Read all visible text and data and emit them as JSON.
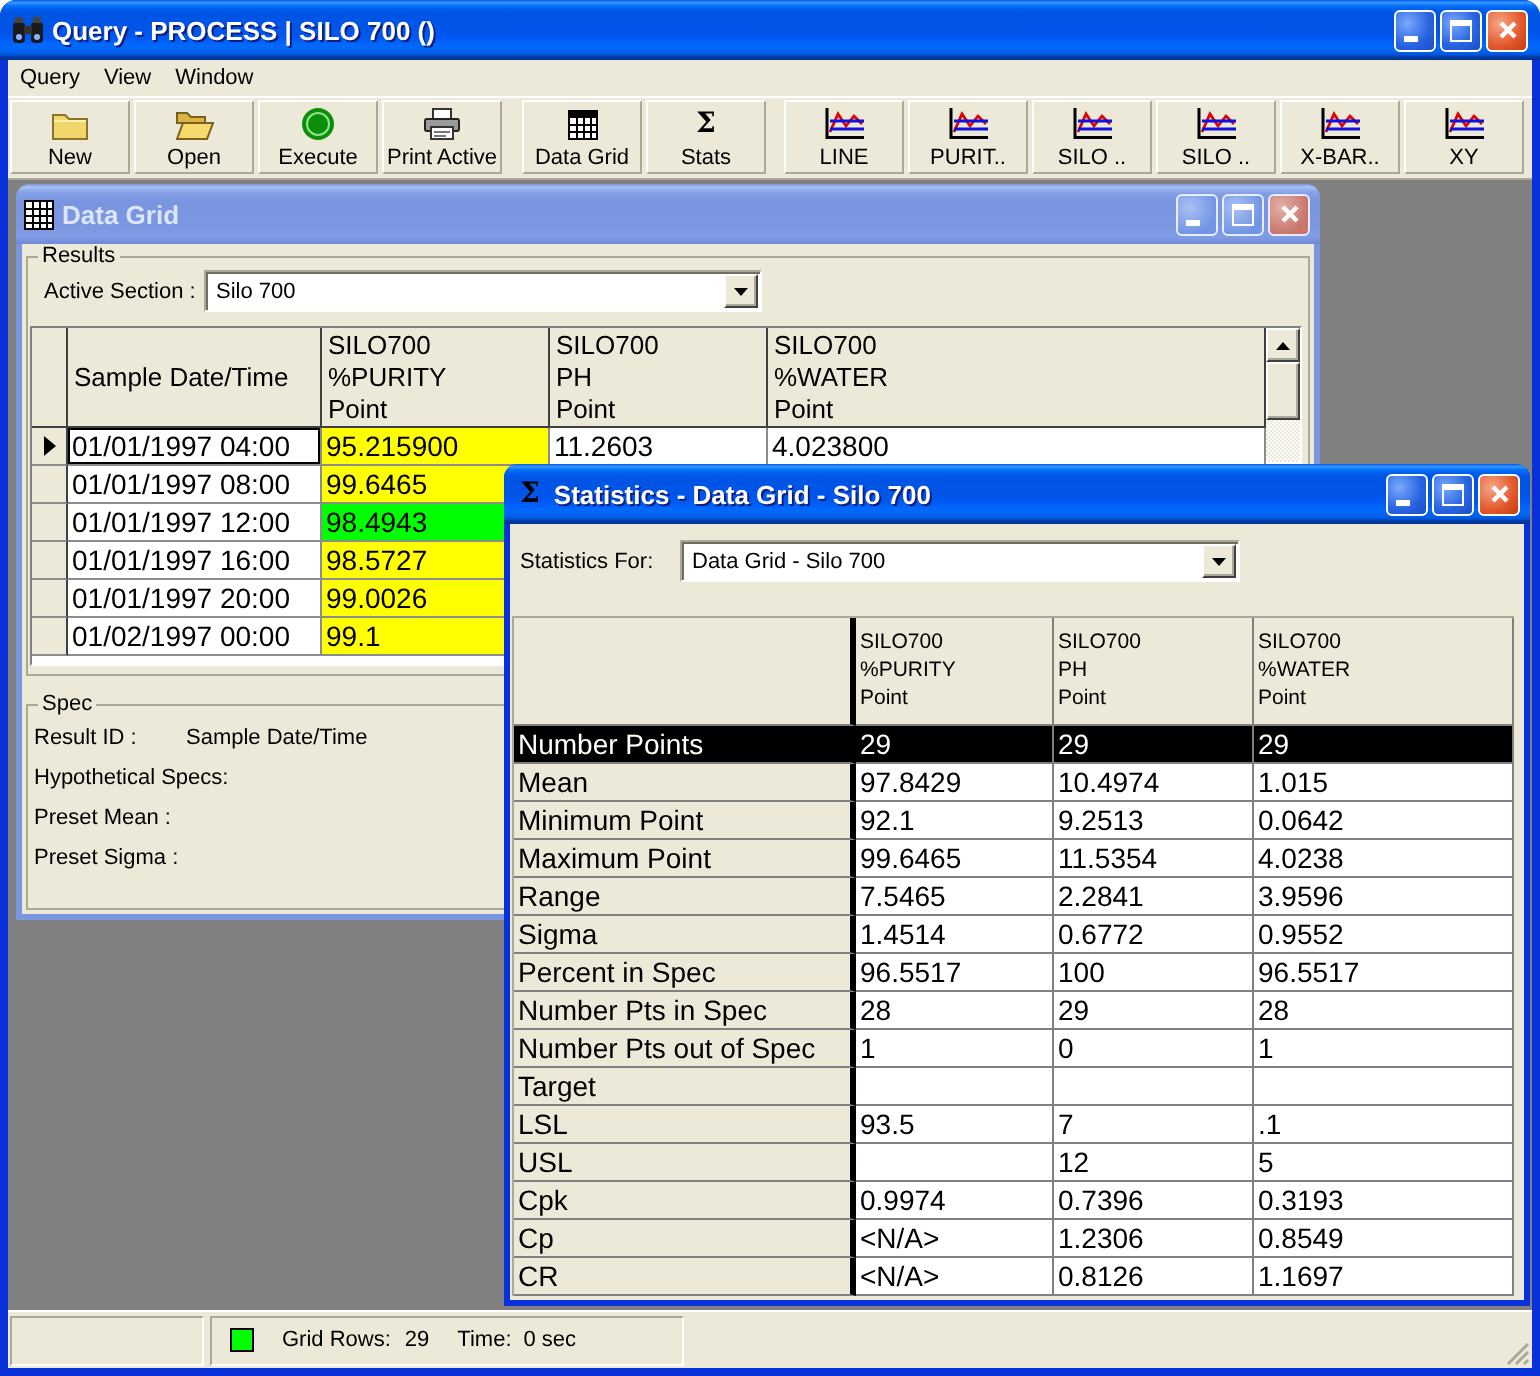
{
  "window": {
    "title": "Query - PROCESS | SILO 700 ()",
    "active": true
  },
  "menu": [
    {
      "label": "Query"
    },
    {
      "label": "View"
    },
    {
      "label": "Window"
    }
  ],
  "toolbar": [
    {
      "buttons": [
        {
          "label": "New",
          "kind": "folder"
        },
        {
          "label": "Open",
          "kind": "open-folder"
        },
        {
          "label": "Execute",
          "kind": "go"
        },
        {
          "label": "Print Active",
          "kind": "printer"
        }
      ]
    },
    {
      "buttons": [
        {
          "label": "Data Grid",
          "kind": "grid"
        },
        {
          "label": "Stats",
          "kind": "sigma",
          "glyph": "Σ"
        }
      ]
    },
    {
      "buttons": [
        {
          "label": "LINE",
          "kind": "chart"
        },
        {
          "label": "PURIT..",
          "kind": "chart"
        },
        {
          "label": "SILO ..",
          "kind": "chart"
        },
        {
          "label": "SILO ..",
          "kind": "chart"
        },
        {
          "label": "X-BAR..",
          "kind": "chart"
        },
        {
          "label": "XY",
          "kind": "chart"
        }
      ]
    }
  ],
  "data_grid_window": {
    "title": "Data Grid",
    "active": false,
    "results": {
      "label": "Results",
      "active_section": {
        "label": "Active Section :",
        "value": "Silo 700"
      },
      "columns": [
        "Sample Date/Time",
        "SILO700\n%PURITY\nPoint",
        "SILO700\nPH\nPoint",
        "SILO700\n%WATER\nPoint"
      ],
      "rows": [
        {
          "selected": true,
          "cells": [
            {
              "text": "01/01/1997 04:00"
            },
            {
              "text": "95.215900",
              "color": "#ffff00"
            },
            {
              "text": "11.2603"
            },
            {
              "text": "4.023800"
            }
          ]
        },
        {
          "selected": false,
          "cells": [
            {
              "text": "01/01/1997 08:00"
            },
            {
              "text": "99.6465",
              "color": "#ffff00"
            }
          ]
        },
        {
          "selected": false,
          "cells": [
            {
              "text": "01/01/1997 12:00"
            },
            {
              "text": "98.4943",
              "color": "#00ff00"
            }
          ]
        },
        {
          "selected": false,
          "cells": [
            {
              "text": "01/01/1997 16:00"
            },
            {
              "text": "98.5727",
              "color": "#ffff00"
            }
          ]
        },
        {
          "selected": false,
          "cells": [
            {
              "text": "01/01/1997 20:00"
            },
            {
              "text": "99.0026",
              "color": "#ffff00"
            }
          ]
        },
        {
          "selected": false,
          "cells": [
            {
              "text": "01/02/1997 00:00"
            },
            {
              "text": "99.1",
              "color": "#ffff00"
            }
          ]
        }
      ]
    },
    "spec": {
      "label": "Spec",
      "fields": [
        {
          "label": "Result ID :",
          "value": "Sample Date/Time"
        },
        {
          "label": "Hypothetical Specs:"
        },
        {
          "label": "Preset Mean :"
        },
        {
          "label": "Preset Sigma :"
        }
      ]
    }
  },
  "statistics_window": {
    "title": "Statistics - Data Grid - Silo 700",
    "glyph": "Σ",
    "active": true,
    "statistics_for": {
      "label": "Statistics For:",
      "value": "Data Grid - Silo 700"
    },
    "columns": [
      "SILO700\n%PURITY\nPoint",
      "SILO700\nPH\nPoint",
      "SILO700\n%WATER\nPoint"
    ],
    "rows": [
      {
        "label": "Number Points",
        "selected": true,
        "purity": "29",
        "ph": "29",
        "water": "29"
      },
      {
        "label": "Mean",
        "selected": false,
        "purity": "97.8429",
        "ph": "10.4974",
        "water": "1.015"
      },
      {
        "label": "Minimum Point",
        "selected": false,
        "purity": "92.1",
        "ph": "9.2513",
        "water": "0.0642"
      },
      {
        "label": "Maximum Point",
        "selected": false,
        "purity": "99.6465",
        "ph": "11.5354",
        "water": "4.0238"
      },
      {
        "label": "Range",
        "selected": false,
        "purity": "7.5465",
        "ph": "2.2841",
        "water": "3.9596"
      },
      {
        "label": "Sigma",
        "selected": false,
        "purity": "1.4514",
        "ph": "0.6772",
        "water": "0.9552"
      },
      {
        "label": "Percent in Spec",
        "selected": false,
        "purity": "96.5517",
        "ph": "100",
        "water": "96.5517"
      },
      {
        "label": "Number Pts in Spec",
        "selected": false,
        "purity": "28",
        "ph": "29",
        "water": "28"
      },
      {
        "label": "Number Pts out of Spec",
        "selected": false,
        "purity": "1",
        "ph": "0",
        "water": "1"
      },
      {
        "label": "Target",
        "selected": false
      },
      {
        "label": "LSL",
        "selected": false,
        "purity": "93.5",
        "ph": "7",
        "water": ".1"
      },
      {
        "label": "USL",
        "selected": false,
        "ph": "12",
        "water": "5"
      },
      {
        "label": "Cpk",
        "selected": false,
        "purity": "0.9974",
        "ph": "0.7396",
        "water": "0.3193"
      },
      {
        "label": "Cp",
        "selected": false,
        "purity": "<N/A>",
        "ph": "1.2306",
        "water": "0.8549"
      },
      {
        "label": "CR",
        "selected": false,
        "purity": "<N/A>",
        "ph": "0.8126",
        "water": "1.1697"
      }
    ]
  },
  "status_bar": {
    "indicator": {
      "color": "#00ff00"
    },
    "grid_rows_label": "Grid Rows:",
    "grid_rows": "29",
    "time_label": "Time:",
    "time": "0 sec"
  }
}
